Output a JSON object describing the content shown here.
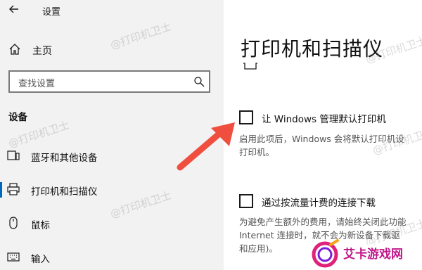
{
  "app": {
    "title": "设置"
  },
  "sidebar": {
    "home_label": "主页",
    "search_placeholder": "查找设置",
    "section_title": "设备",
    "items": [
      {
        "label": "蓝牙和其他设备",
        "icon": "bluetooth-devices-icon"
      },
      {
        "label": "打印机和扫描仪",
        "icon": "printer-icon",
        "active": true
      },
      {
        "label": "鼠标",
        "icon": "mouse-icon"
      },
      {
        "label": "输入",
        "icon": "keyboard-icon"
      }
    ]
  },
  "main": {
    "title": "打印机和扫描仪",
    "options": [
      {
        "label": "让 Windows 管理默认打印机",
        "checked": false,
        "description_lines": [
          "启用此项后，Windows 会将默认打印机设",
          "打印机。"
        ]
      },
      {
        "label": "通过按流量计费的连接下载",
        "checked": false,
        "description_lines": [
          "为避免产生额外的费用，请始终关闭此功能",
          "Internet 连接时，就不会为新设备下载驱",
          "和应用)。"
        ]
      }
    ]
  },
  "watermark_text": "@打印机卫士",
  "brand_logo_text": "艾卡游戏网",
  "colors": {
    "accent": "#0067c0",
    "arrow": "#f04e3e",
    "sidebar_bg": "#f2f2f2"
  }
}
